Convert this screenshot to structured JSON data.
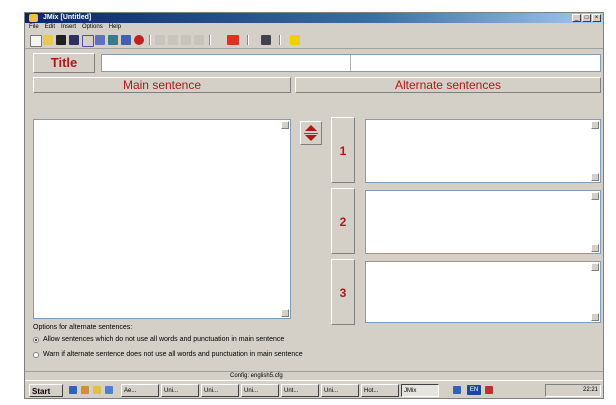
{
  "window": {
    "title": "JMix [Untitled]",
    "controls": [
      "_",
      "□",
      "×"
    ]
  },
  "menu": [
    "File",
    "Edit",
    "Insert",
    "Options",
    "Help"
  ],
  "toolbar_icons": [
    "new-file-icon",
    "open-folder-icon",
    "save-icon",
    "save-as-icon",
    "eraser-icon",
    "export-icon",
    "web-icon",
    "task-icon",
    "add-icon",
    "cut-icon",
    "copy-icon",
    "paste-icon",
    "undo-icon",
    "hp-icon",
    "config-icon",
    "help-icon"
  ],
  "title_label": "Title",
  "main_header": "Main sentence",
  "alt_header": "Alternate sentences",
  "alt_numbers": [
    "1",
    "2",
    "3"
  ],
  "options": {
    "heading": "Options for alternate sentences:",
    "allow": "Allow sentences which do not use all words and punctuation in main sentence",
    "warn": "Warn if alternate sentence does not use all words and punctuation in main sentence",
    "selected": "allow"
  },
  "status": {
    "config": "Config: english5.cfg"
  },
  "taskbar": {
    "start": "Start",
    "tasks": [
      "Ae...",
      "Uni...",
      "Uni...",
      "Uni...",
      "Unt...",
      "Uni...",
      "Hot...",
      "JMix"
    ],
    "active": "JMix",
    "clock": "22:21",
    "lang": "EN"
  }
}
